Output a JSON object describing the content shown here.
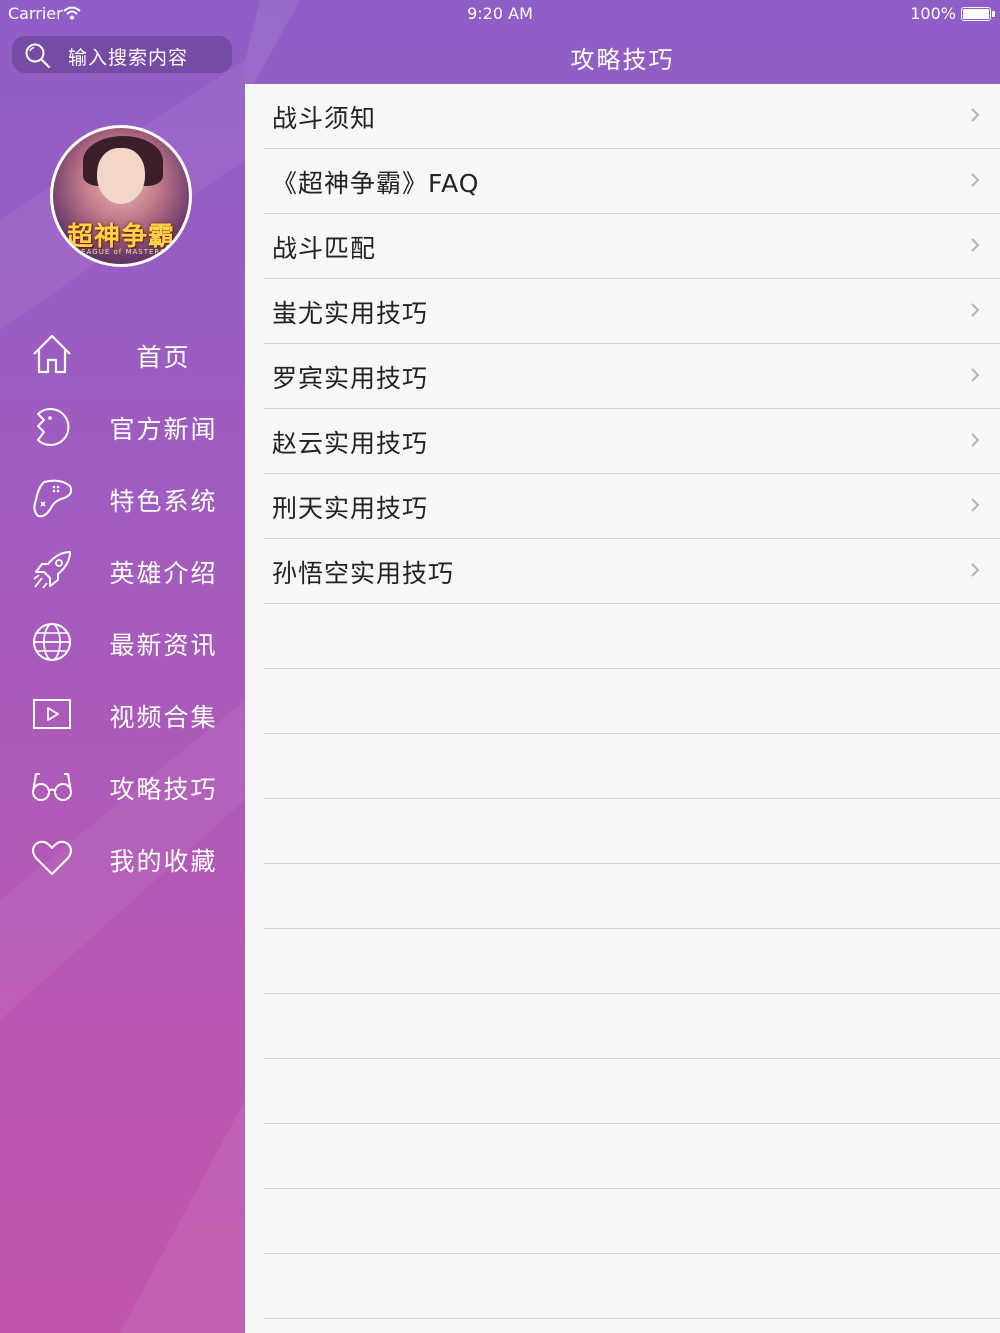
{
  "status_bar": {
    "carrier": "Carrier",
    "time": "9:20 AM",
    "battery": "100%"
  },
  "search": {
    "placeholder": "输入搜索内容",
    "icon": "search-icon"
  },
  "nav": {
    "title": "攻略技巧"
  },
  "avatar": {
    "logo_text": "超神争霸",
    "logo_subtext": "LEAGUE of MASTERS"
  },
  "menu": {
    "items": [
      {
        "label": "首页",
        "icon": "home-icon"
      },
      {
        "label": "官方新闻",
        "icon": "news-icon"
      },
      {
        "label": "特色系统",
        "icon": "gamepad-icon"
      },
      {
        "label": "英雄介绍",
        "icon": "rocket-icon"
      },
      {
        "label": "最新资讯",
        "icon": "globe-icon"
      },
      {
        "label": "视频合集",
        "icon": "video-icon"
      },
      {
        "label": "攻略技巧",
        "icon": "glasses-icon"
      },
      {
        "label": "我的收藏",
        "icon": "heart-icon"
      }
    ]
  },
  "list": {
    "items": [
      "战斗须知",
      "《超神争霸》FAQ",
      "战斗匹配",
      "蚩尤实用技巧",
      "罗宾实用技巧",
      "赵云实用技巧",
      "刑天实用技巧",
      "孙悟空实用技巧"
    ]
  },
  "colors": {
    "accent_purple": "#8f5ec6",
    "accent_pink": "#c056ab",
    "list_bg": "#f7f7f7",
    "separator": "#d6d6d6"
  }
}
